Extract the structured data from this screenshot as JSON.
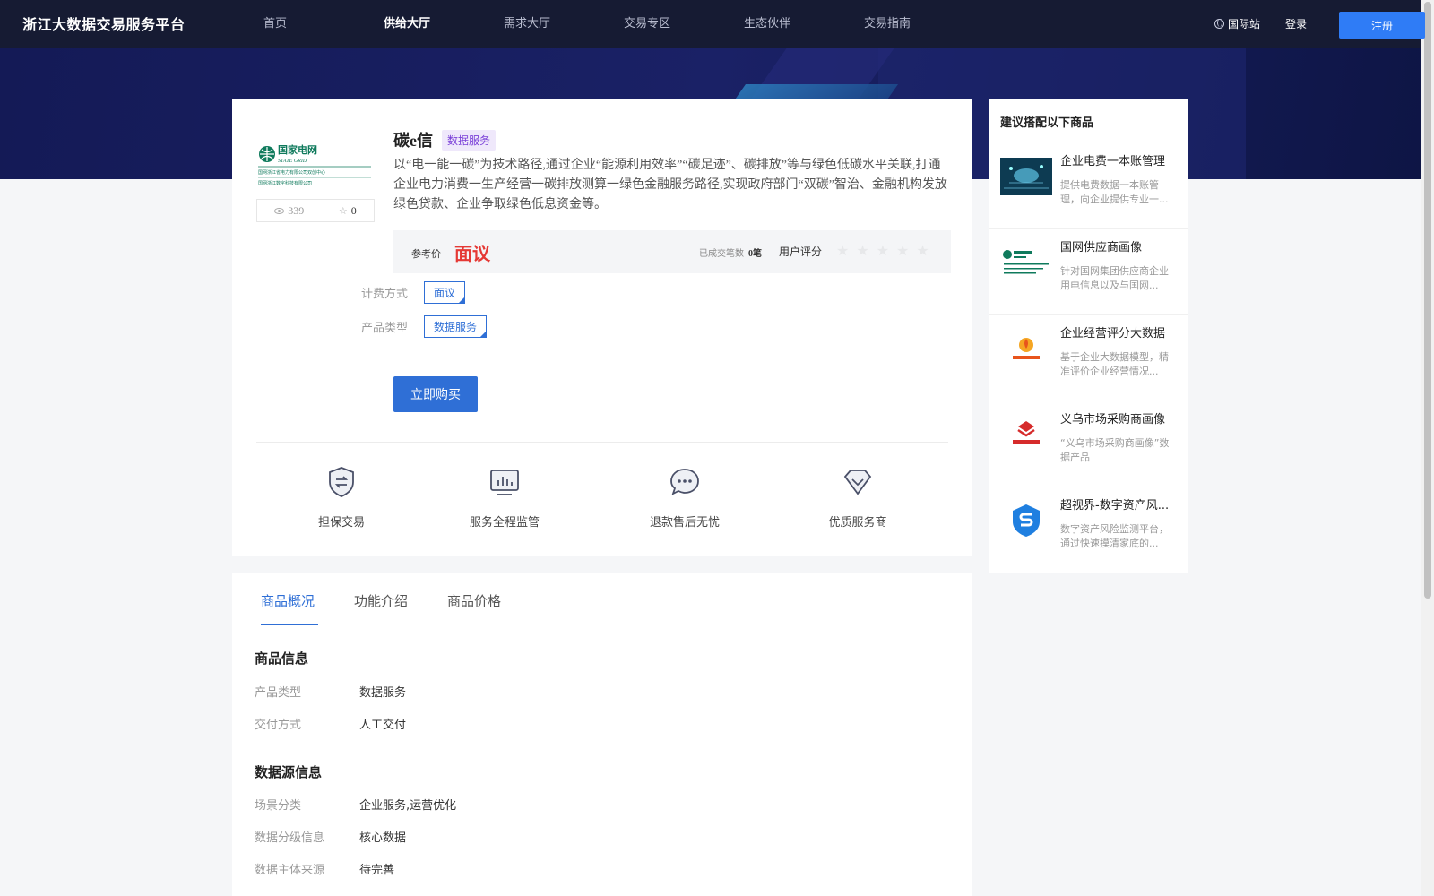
{
  "header": {
    "logo": "浙江大数据交易服务平台",
    "nav": [
      {
        "label": "首页",
        "active": false
      },
      {
        "label": "供给大厅",
        "active": true
      },
      {
        "label": "需求大厅",
        "active": false
      },
      {
        "label": "交易专区",
        "active": false
      },
      {
        "label": "生态伙伴",
        "active": false
      },
      {
        "label": "交易指南",
        "active": false
      }
    ],
    "intl_label": "国际站",
    "login_label": "登录",
    "register_label": "注册"
  },
  "product": {
    "logo_text": "国家电网",
    "logo_sub": "STATE GRID",
    "logo_line1": "国网浙江省电力有限公司双创中心",
    "logo_line2": "国网浙江数字科技有限公司",
    "views": "339",
    "favorites": "0",
    "name": "碳e信",
    "tag": "数据服务",
    "description": "以“电一能一碳”为技术路径,通过企业“能源利用效率”“碳足迹”、碳排放”等与绿色低碳水平关联,打通企业电力消费一生产经营一碳排放测算一绿色金融服务路径,实现政府部门“双碳”智治、金融机构发放绿色贷款、企业争取绿色低息资金等。",
    "price_label": "参考价",
    "price_value": "面议",
    "deals_label": "已成交笔数",
    "deals_value": "0笔",
    "rating_label": "用户评分",
    "rating_stars": 0,
    "billing_label": "计费方式",
    "billing_value": "面议",
    "type_label": "产品类型",
    "type_value": "数据服务",
    "buy_label": "立即购买"
  },
  "guarantees": [
    {
      "label": "担保交易",
      "icon": "shield-exchange-icon"
    },
    {
      "label": "服务全程监管",
      "icon": "monitor-chart-icon"
    },
    {
      "label": "退款售后无忧",
      "icon": "chat-bubble-icon"
    },
    {
      "label": "优质服务商",
      "icon": "diamond-check-icon"
    }
  ],
  "tabs": [
    {
      "label": "商品概况",
      "active": true
    },
    {
      "label": "功能介绍",
      "active": false
    },
    {
      "label": "商品价格",
      "active": false
    }
  ],
  "goods_info": {
    "title": "商品信息",
    "rows": [
      {
        "k": "产品类型",
        "v": "数据服务"
      },
      {
        "k": "交付方式",
        "v": "人工交付"
      }
    ]
  },
  "source_info": {
    "title": "数据源信息",
    "rows": [
      {
        "k": "场景分类",
        "v": "企业服务,运营优化"
      },
      {
        "k": "数据分级信息",
        "v": "核心数据"
      },
      {
        "k": "数据主体来源",
        "v": "待完善"
      }
    ]
  },
  "side": {
    "title": "建议搭配以下商品",
    "items": [
      {
        "name": "企业电费一本账管理",
        "desc": "提供电费数据一本账管理，向企业提供专业一...",
        "thumb": "cloud-data-thumb"
      },
      {
        "name": "国网供应商画像",
        "desc": "针对国网集团供应商企业用电信息以及与国网...",
        "thumb": "state-grid-thumb"
      },
      {
        "name": "企业经营评分大数据",
        "desc": "基于企业大数据模型，精准评价企业经营情况...",
        "thumb": "huoshi-thumb"
      },
      {
        "name": "义乌市场采购商画像",
        "desc": "“义乌市场采购商画像”数据产品",
        "thumb": "yiwu-thumb"
      },
      {
        "name": "超视界-数字资产风...",
        "desc": "数字资产风险监测平台，通过快速摸清家底的...",
        "thumb": "s-shield-thumb"
      }
    ]
  },
  "colors": {
    "primary": "#2f6fd6",
    "header_bg": "#161b33",
    "price": "#e53935",
    "tag_purple": "#7a3fd8"
  }
}
